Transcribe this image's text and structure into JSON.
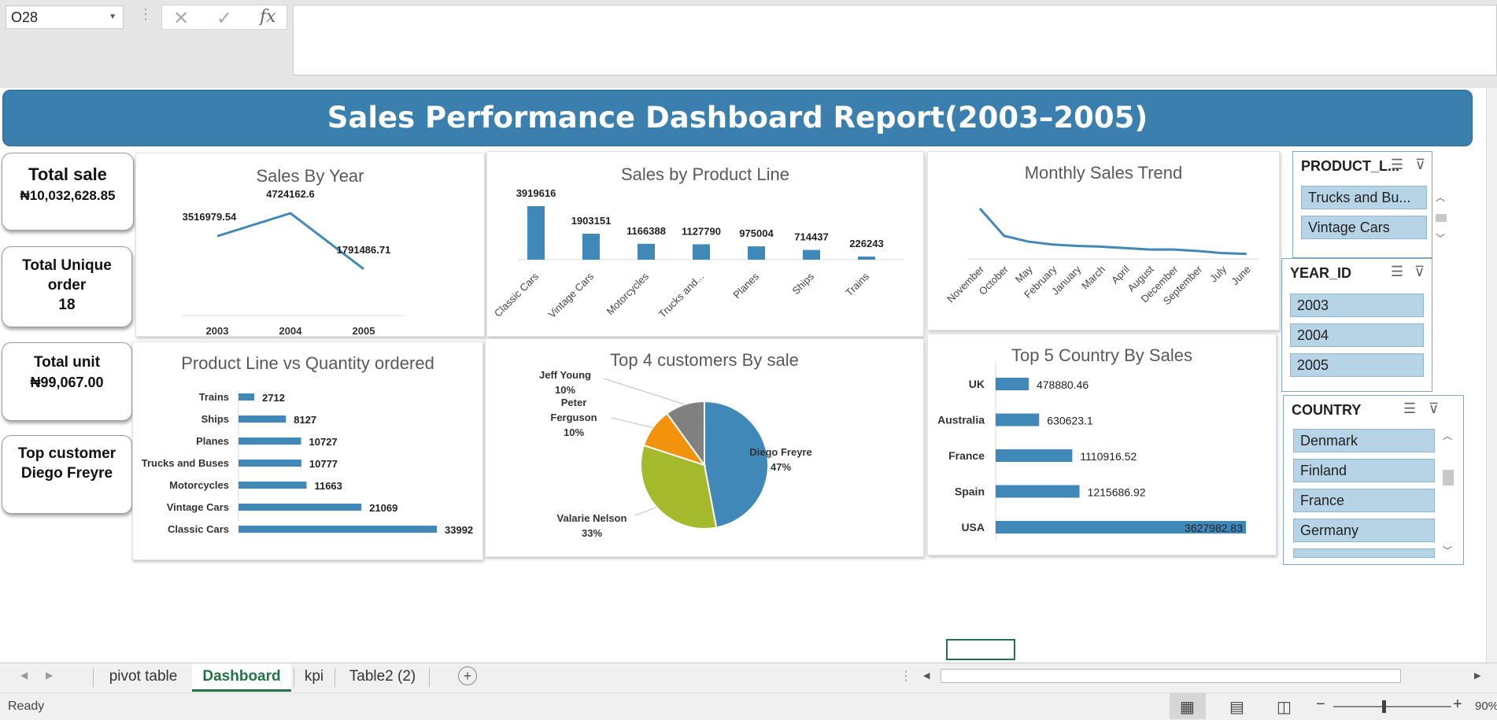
{
  "formula_bar": {
    "name_box": "O28",
    "cancel_icon": "✕",
    "enter_icon": "✓",
    "fx_icon": "fx",
    "formula": ""
  },
  "dashboard_title": "Sales Performance Dashboard Report(2003–2005)",
  "kpis": {
    "total_sale_label": "Total sale",
    "total_sale_value": "₦10,032,628.85",
    "unique_order_label_1": "Total Unique",
    "unique_order_label_2": "order",
    "unique_order_value": "18",
    "total_unit_label": "Total unit",
    "total_unit_value": "₦99,067.00",
    "top_customer_label": "Top customer",
    "top_customer_value": "Diego Freyre"
  },
  "chart_data": [
    {
      "type": "line",
      "title": "Sales By Year",
      "x": [
        "2003",
        "2004",
        "2005"
      ],
      "values": [
        3516979.54,
        4724162.6,
        1791486.71
      ],
      "data_labels": [
        "3516979.54",
        "4724162.6",
        "1791486.71"
      ]
    },
    {
      "type": "bar",
      "title": "Sales by Product Line",
      "categories": [
        "Classic Cars",
        "Vintage Cars",
        "Motorcycles",
        "Trucks and...",
        "Planes",
        "Ships",
        "Trains"
      ],
      "values": [
        3919616,
        1903151,
        1166388,
        1127790,
        975004,
        714437,
        226243
      ]
    },
    {
      "type": "line",
      "title": "Monthly Sales Trend",
      "x": [
        "November",
        "October",
        "May",
        "February",
        "January",
        "March",
        "April",
        "August",
        "December",
        "September",
        "July",
        "June"
      ],
      "values": [
        1.0,
        0.62,
        0.54,
        0.5,
        0.48,
        0.47,
        0.45,
        0.43,
        0.43,
        0.41,
        0.38,
        0.37
      ]
    },
    {
      "type": "bar",
      "orientation": "horizontal",
      "title": "Product Line vs Quantity ordered",
      "categories": [
        "Trains",
        "Ships",
        "Planes",
        "Trucks and Buses",
        "Motorcycles",
        "Vintage Cars",
        "Classic Cars"
      ],
      "values": [
        2712,
        8127,
        10727,
        10777,
        11663,
        21069,
        33992
      ]
    },
    {
      "type": "pie",
      "title": "Top 4 customers By sale",
      "slices": [
        {
          "label": "Diego Freyre",
          "pct": "47%",
          "value": 47,
          "color": "#3f88b8"
        },
        {
          "label": "Valarie Nelson",
          "pct": "33%",
          "value": 33,
          "color": "#a5b92c"
        },
        {
          "label": "Peter Ferguson",
          "pct": "10%",
          "value": 10,
          "color": "#f2930b"
        },
        {
          "label": "Jeff Young",
          "pct": "10%",
          "value": 10,
          "color": "#808080"
        }
      ]
    },
    {
      "type": "bar",
      "orientation": "horizontal",
      "title": "Top 5  Country  By Sales",
      "categories": [
        "UK",
        "Australia",
        "France",
        "Spain",
        "USA"
      ],
      "values": [
        478880.46,
        630623.1,
        1110916.52,
        1215686.92,
        3627982.83
      ],
      "data_labels": [
        "478880.46",
        "630623.1",
        "1110916.52",
        "1215686.92",
        "3627982.83"
      ]
    }
  ],
  "slicers": {
    "product_line": {
      "title": "PRODUCT_L...",
      "items": [
        "Trucks and Bu...",
        "Vintage Cars"
      ]
    },
    "year": {
      "title": "YEAR_ID",
      "items": [
        "2003",
        "2004",
        "2005"
      ]
    },
    "country": {
      "title": "COUNTRY",
      "items": [
        "Denmark",
        "Finland",
        "France",
        "Germany"
      ]
    }
  },
  "tabs": [
    "pivot table",
    "Dashboard",
    "kpi",
    "Table2 (2)"
  ],
  "active_tab": "Dashboard",
  "status": {
    "ready": "Ready",
    "zoom": "90%"
  },
  "colors": {
    "accent": "#3a7fad",
    "bar": "#3f88b8",
    "excel_green": "#217346"
  }
}
